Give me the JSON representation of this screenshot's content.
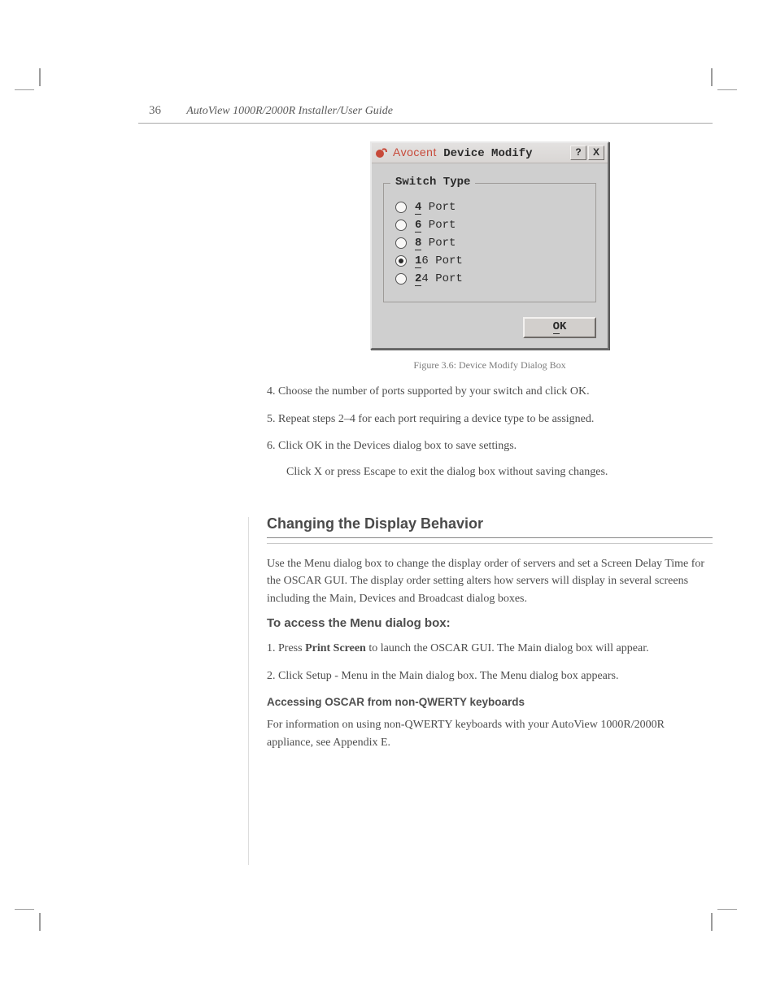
{
  "page_number": "36",
  "running_head": "AutoView 1000R/2000R Installer/User Guide",
  "figure": {
    "caption": "Figure 3.6: Device Modify Dialog Box",
    "dialog": {
      "brand": "Avocent",
      "title_rest": "Device Modify",
      "help_btn": "?",
      "close_btn": "X",
      "group_legend": "Switch Type",
      "options": [
        {
          "mnemonic": "4",
          "rest": " Port",
          "checked": false
        },
        {
          "mnemonic": "6",
          "rest": " Port",
          "checked": false
        },
        {
          "mnemonic": "8",
          "rest": " Port",
          "checked": false
        },
        {
          "mnemonic": "1",
          "rest": "6 Port",
          "checked": true
        },
        {
          "mnemonic": "2",
          "rest": "4 Port",
          "checked": false
        }
      ],
      "ok_mn": "O",
      "ok_rest": "K"
    }
  },
  "steps": {
    "s4": "4.   Choose the number of ports supported by your switch and click OK.",
    "s5": "5.   Repeat steps 2–4 for each port requiring a device type to be assigned.",
    "s6": "6.   Click OK in the Devices dialog box to save settings.",
    "s6b": "Click X or press Escape to exit the dialog box without saving changes."
  },
  "section": {
    "h2": "Changing the Display Behavior",
    "p1": "Use the Menu dialog box to change the display order of servers and set a Screen Delay Time for the OSCAR GUI. The display order setting alters how servers will display in several screens including the Main, Devices and Broadcast dialog boxes.",
    "h3": "To access the Menu dialog box:",
    "p2a": "1.   Press ",
    "p2key": "Print Screen",
    "p2b": " to launch the OSCAR GUI. The Main dialog box will appear.",
    "p3": "2.   Click Setup - Menu in the Main dialog box. The Menu dialog box appears.",
    "h4": "Accessing OSCAR from non-QWERTY keyboards",
    "p4": "For information on using non-QWERTY keyboards with your AutoView 1000R/2000R appliance, see Appendix E."
  }
}
